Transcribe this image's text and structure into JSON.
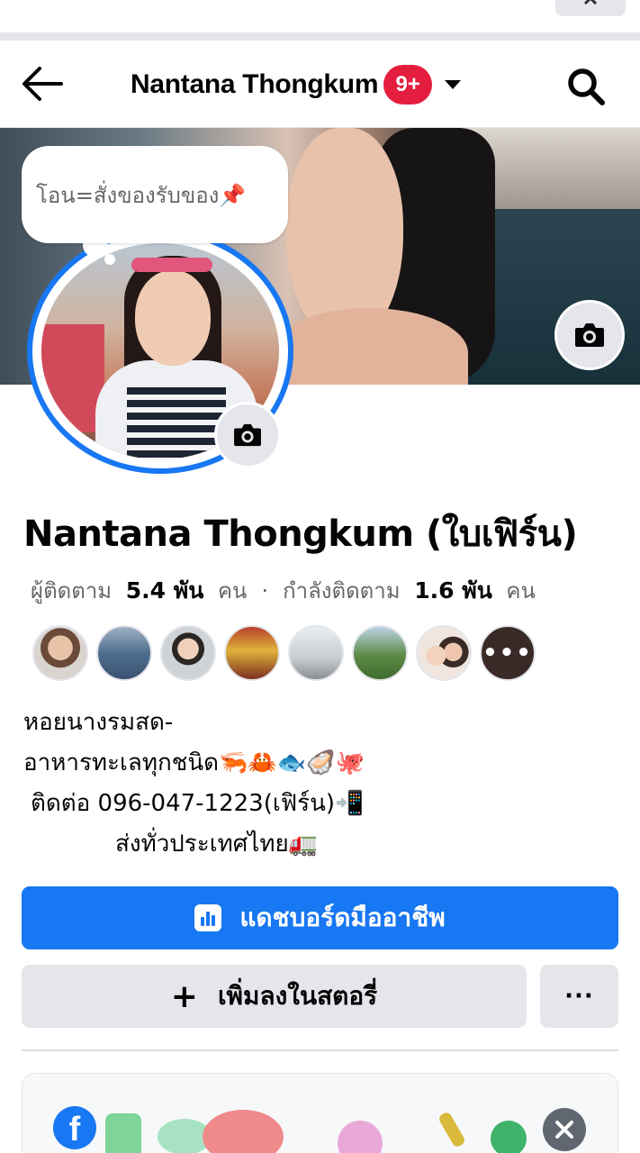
{
  "header": {
    "title": "Nantana Thongkum",
    "notification_badge": "9+"
  },
  "profile": {
    "status_note": "โอน=สั่งของรับของ📌",
    "name": "Nantana Thongkum (ใบเฟิร์น)",
    "followers_label": "ผู้ติดตาม",
    "followers_count": "5.4 พัน",
    "followers_unit": "คน",
    "separator": "·",
    "following_label": "กำลังติดตาม",
    "following_count": "1.6 พัน",
    "following_unit": "คน",
    "friends_more": "•••",
    "bio": [
      "หอยนางรมสด-",
      "อาหารทะเลทุกชนิด🦐🦀🐟🦪🐙",
      "ติดต่อ 096-047-1223(เฟิร์น)📲",
      "ส่งทั่วประเทศไทย🚛"
    ]
  },
  "actions": {
    "dashboard": "แดชบอร์ดมืออาชีพ",
    "add_story_icon": "+",
    "add_story": "เพิ่มลงในสตอรี่",
    "more": "···"
  },
  "promo_card": {
    "logo_letter": "f"
  },
  "colors": {
    "brand_blue": "#1877f2",
    "badge_red": "#e41e3f",
    "button_gray": "#e4e6eb",
    "secondary_text": "#65676b"
  },
  "icons": [
    "back-arrow-icon",
    "search-icon",
    "caret-down-icon",
    "camera-icon",
    "dashboard-icon",
    "plus-icon",
    "more-icon",
    "facebook-logo-icon",
    "close-icon"
  ]
}
